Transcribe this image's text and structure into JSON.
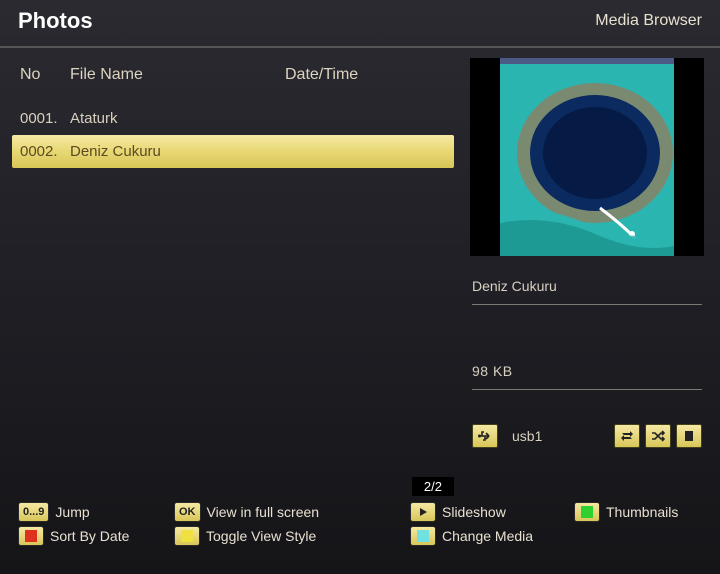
{
  "header": {
    "title": "Photos",
    "subtitle": "Media Browser"
  },
  "columns": {
    "no": "No",
    "name": "File Name",
    "date": "Date/Time"
  },
  "rows": [
    {
      "no": "0001.",
      "name": "Ataturk",
      "selected": false
    },
    {
      "no": "0002.",
      "name": "Deniz Cukuru",
      "selected": true
    }
  ],
  "page": "2/2",
  "preview": {
    "name": "Deniz Cukuru",
    "size": "98 KB"
  },
  "storage": {
    "name": "usb1"
  },
  "footer": {
    "jump_key": "0...9",
    "jump": "Jump",
    "ok_key": "OK",
    "ok": "View in full screen",
    "slideshow": "Slideshow",
    "thumbnails": "Thumbnails",
    "sort": "Sort By Date",
    "toggle": "Toggle View Style",
    "change": "Change Media"
  }
}
